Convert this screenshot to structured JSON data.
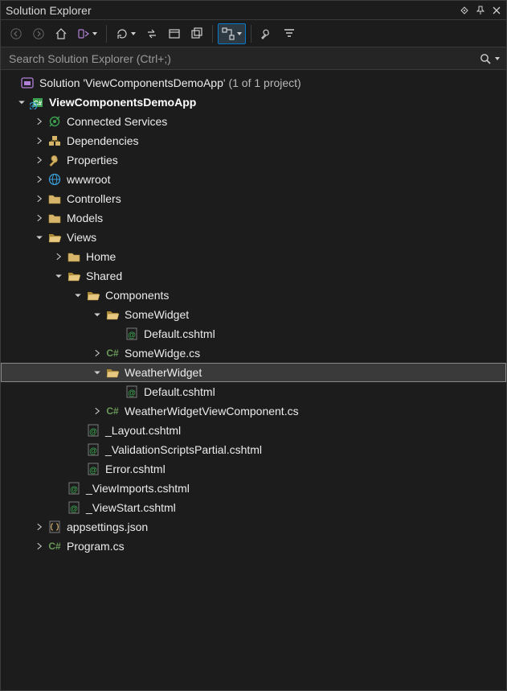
{
  "title": "Solution Explorer",
  "search": {
    "placeholder": "Search Solution Explorer (Ctrl+;)"
  },
  "solution": {
    "prefix": "Solution '",
    "name": "ViewComponentsDemoApp",
    "suffix": "' (1 of 1 project)"
  },
  "project": "ViewComponentsDemoApp",
  "items": {
    "connected": "Connected Services",
    "deps": "Dependencies",
    "props": "Properties",
    "wwwroot": "wwwroot",
    "controllers": "Controllers",
    "models": "Models",
    "views": "Views",
    "home": "Home",
    "shared": "Shared",
    "components": "Components",
    "somewidget": "SomeWidget",
    "default1": "Default.cshtml",
    "somewidgecs": "SomeWidge.cs",
    "weatherwidget": "WeatherWidget",
    "default2": "Default.cshtml",
    "weathervc": "WeatherWidgetViewComponent.cs",
    "layout": "_Layout.cshtml",
    "valscripts": "_ValidationScriptsPartial.cshtml",
    "error": "Error.cshtml",
    "viewimports": "_ViewImports.cshtml",
    "viewstart": "_ViewStart.cshtml",
    "appsettings": "appsettings.json",
    "programcs": "Program.cs"
  },
  "cs_prefix": "C#"
}
